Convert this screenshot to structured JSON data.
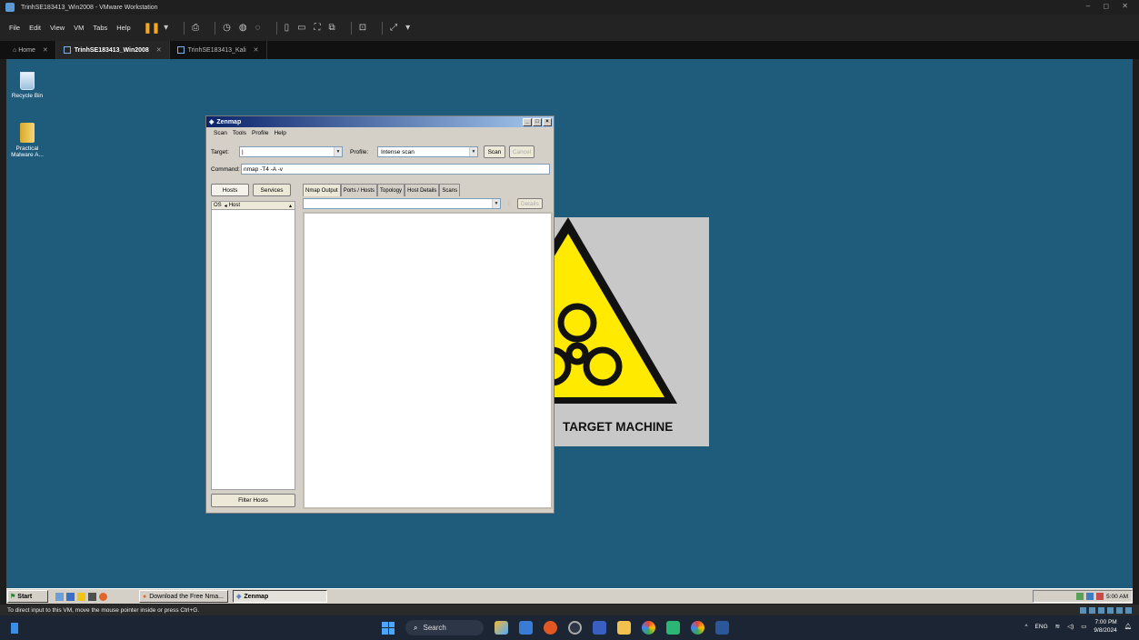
{
  "vmware": {
    "window_title": "TrinhSE183413_Win2008 - VMware Workstation",
    "window_controls": "– ◻ ✕",
    "menu": [
      "File",
      "Edit",
      "View",
      "VM",
      "Tabs",
      "Help"
    ],
    "tabs": [
      {
        "label": "Home",
        "active": false
      },
      {
        "label": "TrinhSE183413_Win2008",
        "active": true
      },
      {
        "label": "TrinhSE183413_Kali",
        "active": false
      }
    ],
    "status_text": "To direct input to this VM, move the mouse pointer inside or press Ctrl+G."
  },
  "desktop": {
    "icons": [
      {
        "label": "Recycle Bin",
        "icon": "recycle-bin-icon"
      },
      {
        "label": "Practical Malware A...",
        "icon": "folder-icon"
      }
    ],
    "wallpaper_text": "TARGET MACHINE"
  },
  "zenmap": {
    "title": "Zenmap",
    "title_buttons": [
      "_",
      "□",
      "×"
    ],
    "menu": [
      "Scan",
      "Tools",
      "Profile",
      "Help"
    ],
    "target_label": "Target:",
    "target_value": "",
    "profile_label": "Profile:",
    "profile_value": "Intense scan",
    "scan_button": "Scan",
    "cancel_button": "Cancel",
    "command_label": "Command:",
    "command_value": "nmap -T4 -A -v",
    "hosts_tab": "Hosts",
    "services_tab": "Services",
    "col_os": "OS",
    "col_host": "Host",
    "filter_button": "Filter Hosts",
    "result_tabs": [
      "Nmap Output",
      "Ports / Hosts",
      "Topology",
      "Host Details",
      "Scans"
    ],
    "details_button": "Details"
  },
  "guest_taskbar": {
    "start_label": "Start",
    "tasks": [
      {
        "label": "Download the Free Nma...",
        "active": false
      },
      {
        "label": "Zenmap",
        "active": true
      }
    ],
    "clock": "5:00 AM"
  },
  "host_taskbar": {
    "search_label": "Search",
    "lang": "ENG",
    "time": "7:00 PM",
    "date": "9/8/2024"
  },
  "colors": {
    "desktop_bg": "#1f5b7b",
    "vm_chrome": "#232323",
    "warning_yellow": "#ffea00"
  }
}
